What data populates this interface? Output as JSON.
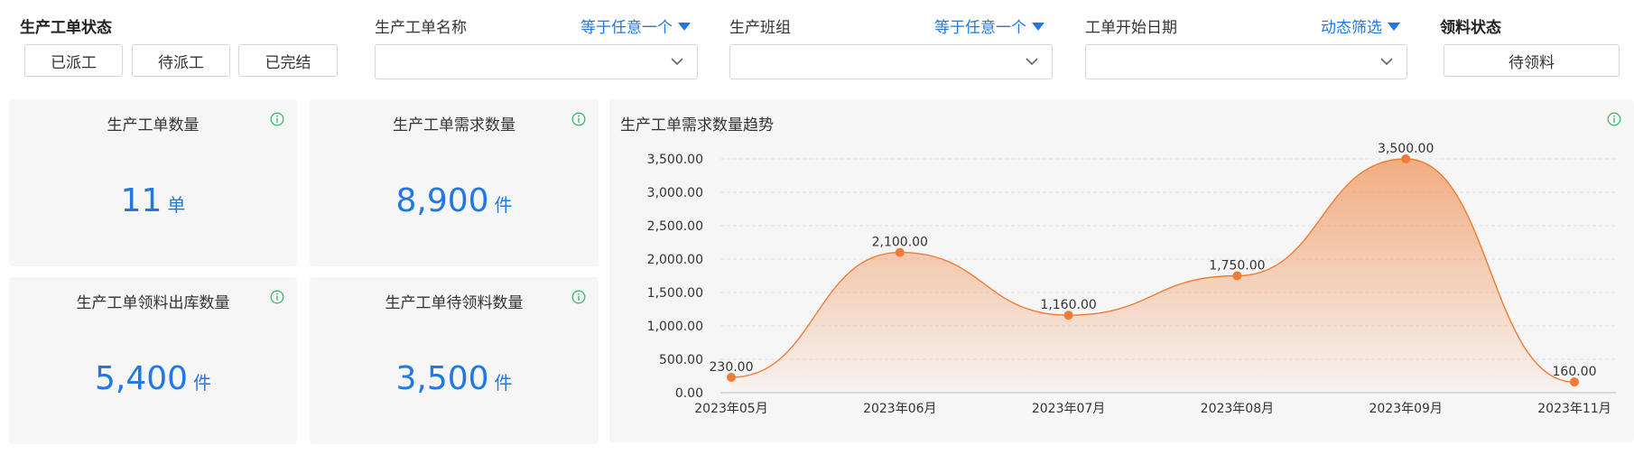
{
  "filters": {
    "status": {
      "label": "生产工单状态",
      "options": [
        "已派工",
        "待派工",
        "已完结"
      ]
    },
    "order_name": {
      "label": "生产工单名称",
      "operator": "等于任意一个"
    },
    "team": {
      "label": "生产班组",
      "operator": "等于任意一个"
    },
    "start_date": {
      "label": "工单开始日期",
      "operator": "动态筛选"
    },
    "material": {
      "label": "领料状态",
      "value": "待领料"
    }
  },
  "cards": [
    {
      "title": "生产工单数量",
      "value": "11",
      "unit": "单"
    },
    {
      "title": "生产工单需求数量",
      "value": "8,900",
      "unit": "件"
    },
    {
      "title": "生产工单领料出库数量",
      "value": "5,400",
      "unit": "件"
    },
    {
      "title": "生产工单待领料数量",
      "value": "3,500",
      "unit": "件"
    }
  ],
  "colors": {
    "accent": "#1f78e8",
    "series": "#f07c33",
    "info": "#3cb86b"
  },
  "chart_data": {
    "type": "area",
    "title": "生产工单需求数量趋势",
    "categories": [
      "2023年05月",
      "2023年06月",
      "2023年07月",
      "2023年08月",
      "2023年09月",
      "2023年11月"
    ],
    "values": [
      230,
      2100,
      1160,
      1750,
      3500,
      160
    ],
    "value_labels": [
      "230.00",
      "2,100.00",
      "1,160.00",
      "1,750.00",
      "3,500.00",
      "160.00"
    ],
    "ylim": [
      0,
      3500
    ],
    "yticks": [
      "0.00",
      "500.00",
      "1,000.00",
      "1,500.00",
      "2,000.00",
      "2,500.00",
      "3,000.00",
      "3,500.00"
    ],
    "grid": true,
    "smooth": true
  }
}
